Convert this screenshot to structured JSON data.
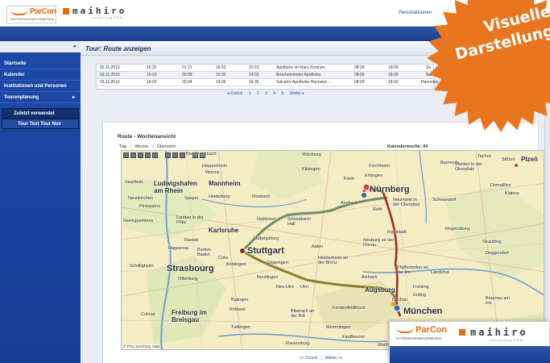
{
  "header": {
    "logo_parcon": "ParCon",
    "logo_parcon_sub": "DATENINGENIEURWESEN",
    "logo_mh": "maihiro",
    "logo_mh_sub": "consulting  CRM",
    "link": "Personalisieren"
  },
  "sidebar": {
    "collapse": "◂",
    "items": [
      {
        "label": "Startseite"
      },
      {
        "label": "Kalender"
      },
      {
        "label": "Institutionen und Personen"
      },
      {
        "label": "Tourenplanung",
        "arrow": "▸"
      }
    ],
    "recent_label": "Zuletzt verwendet",
    "recent_item": "Tour Test Tour Nov"
  },
  "page": {
    "title": "Tour: Route anzeigen"
  },
  "table": {
    "rows": [
      [
        "02.11.2010",
        "15:32",
        "01:21",
        "16:53",
        "10:23",
        "Apotheke im Marx-Zentrum",
        "08:00",
        "18:00",
        "Se"
      ],
      [
        "03.11.2010",
        "10:23",
        "00:09",
        "10:32",
        "14:02",
        "Boschetsrieder Apotheke",
        "08:00",
        "18:00",
        "Basian"
      ],
      [
        "03.11.2010",
        "14:02",
        "00:04",
        "14:06",
        "16:36",
        "Salvator-Apotheke Hanneler...",
        "08:00",
        "18:00",
        "Hanneleo"
      ]
    ],
    "pager": {
      "prev": "◂ Zurück",
      "pages": [
        "1",
        "2",
        "3",
        "4",
        "5"
      ],
      "next": "Weiter ▸"
    }
  },
  "route": {
    "title": "Route - Wochenansicht",
    "views": [
      "Tag",
      "Woche",
      "Übersicht"
    ],
    "calendar_week": "Kalenderwoche: 44",
    "copyright": "© PTV, NAVTEQ, AND",
    "bottom_prev": "<< Zurück",
    "bottom_next": "Weiter >>"
  },
  "map": {
    "cities_big": [
      "Stuttgart",
      "Strasbourg",
      "München",
      "Nürnberg"
    ],
    "cities_med": [
      "Mannheim",
      "Ludwigshafen am Rhein",
      "Heidelberg",
      "Karlsruhe",
      "Freiburg im Breisgau",
      "Augsburg",
      "Ingolstadt",
      "Regensburg",
      "Colmar"
    ],
    "cities_small": [
      "Bad Kreuznach",
      "Heppenheim",
      "Worms",
      "Würzburg",
      "Kitzingen",
      "Forchheim",
      "Erlangen",
      "Fürth",
      "Bayreuth",
      "Tachov",
      "Weiden in der Oberpfalz",
      "Saarlouis",
      "Neunkirchen",
      "Pirmasens",
      "Speyer",
      "Mosbach",
      "Ansbach",
      "Roth",
      "Neumarkt in der Oberpfalz",
      "Schwandorf",
      "Sarreguemines",
      "Landau in der Pfalz",
      "Heilbronn",
      "Schwäbisch Hall",
      "Rastatt",
      "Baden-Baden",
      "Ludwigsburg",
      "Aalen",
      "Neuburg an der Donau",
      "Straubing",
      "Haguenau",
      "Calw",
      "Böblingen",
      "Göppingen",
      "Heidenheim an der Brenz",
      "Pfaffenhofen an der Ilm",
      "Landshut",
      "Schiltigheim",
      "Offenburg",
      "Reutlingen",
      "Neu-Ulm",
      "Ulm",
      "Aichach",
      "Deggendorf",
      "Freising",
      "Erding",
      "Dachau",
      "Fürstenfeldbruck",
      "Balingen",
      "Rottweil",
      "Biberach an der Riß",
      "Memmingen",
      "Kaufbeuren",
      "Tuttlingen",
      "Ravensburg",
      "Weilheim",
      "Braunau am Inn",
      "Domažlice",
      "Klatovy",
      "Stříbro",
      "Plzeň"
    ]
  },
  "badge": {
    "line1": "Visuelle",
    "line2": "Darstellung",
    "color": "#e8761e"
  },
  "colors": {
    "accent": "#1b3f8c",
    "brand_orange": "#e86a10",
    "route_green": "#6b8f6a",
    "route_red": "#a2292c",
    "route_olive": "#8a7d2a"
  }
}
